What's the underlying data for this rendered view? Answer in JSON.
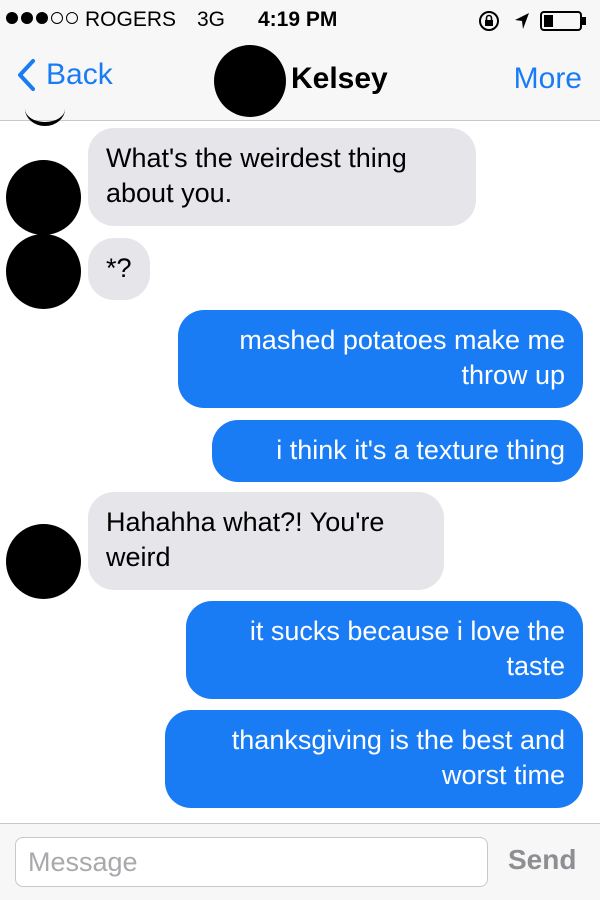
{
  "status_bar": {
    "signal_full": 3,
    "signal_empty": 2,
    "carrier": "ROGERS",
    "network": "3G",
    "time": "4:19 PM"
  },
  "nav": {
    "back_label": "Back",
    "contact_name": "Kelsey",
    "more_label": "More"
  },
  "messages": [
    {
      "direction": "incoming",
      "lines": [
        "What's the weirdest thing",
        "about you."
      ]
    },
    {
      "direction": "incoming",
      "lines": [
        "*?"
      ]
    },
    {
      "direction": "outgoing",
      "lines": [
        "mashed potatoes make me",
        "throw up"
      ]
    },
    {
      "direction": "outgoing",
      "lines": [
        "i think it's a texture thing"
      ]
    },
    {
      "direction": "incoming",
      "lines": [
        "Hahahha what?! You're",
        "weird"
      ]
    },
    {
      "direction": "outgoing",
      "lines": [
        "it sucks because i love the",
        "taste"
      ]
    },
    {
      "direction": "outgoing",
      "lines": [
        "thanksgiving is the best and",
        "worst time"
      ]
    }
  ],
  "composer": {
    "placeholder": "Message",
    "send_label": "Send"
  },
  "colors": {
    "accent": "#1a7cf5",
    "incoming_bubble": "#e5e5ea",
    "outgoing_bubble": "#1a7cf5"
  },
  "icons": [
    "rotation-lock-icon",
    "location-arrow-icon",
    "battery-icon",
    "back-chevron-icon"
  ]
}
